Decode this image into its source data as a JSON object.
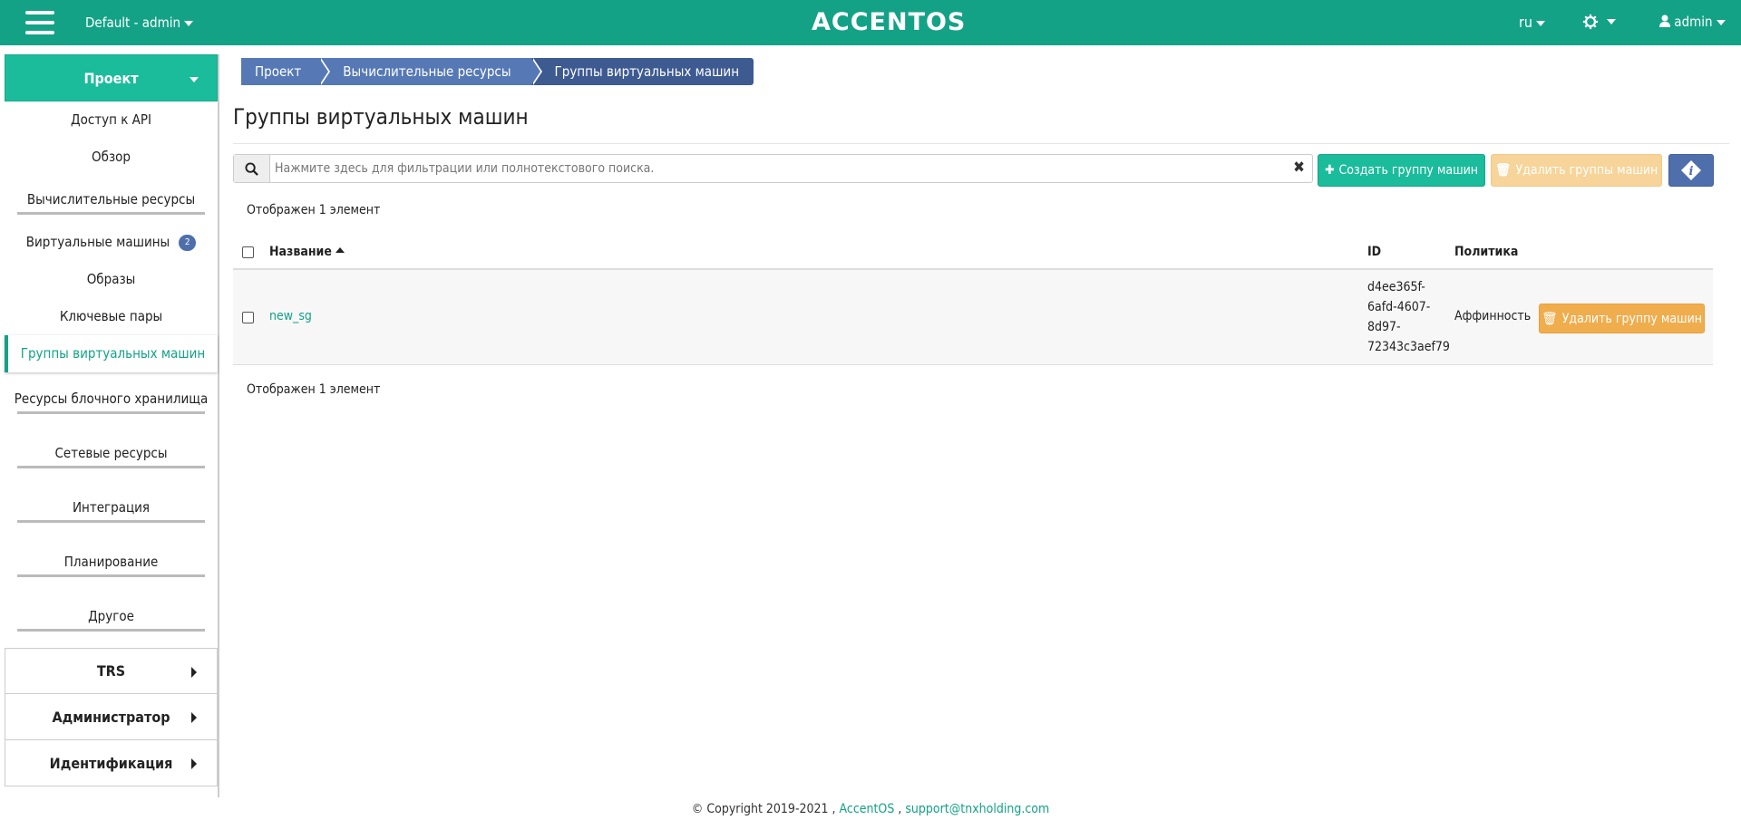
{
  "header": {
    "project": "Default - admin",
    "logo": "ACCENTOS",
    "lang": "ru",
    "user": "admin"
  },
  "sidebar": {
    "project_label": "Проект",
    "items": [
      {
        "label": "Доступ к API"
      },
      {
        "label": "Обзор"
      }
    ],
    "compute_group": "Вычислительные ресурсы",
    "compute_items": [
      {
        "label": "Виртуальные машины",
        "badge": "2"
      },
      {
        "label": "Образы"
      },
      {
        "label": "Ключевые пары"
      },
      {
        "label": "Группы виртуальных машин"
      }
    ],
    "groups": [
      "Ресурсы блочного хранилища",
      "Сетевые ресурсы",
      "Интеграция",
      "Планирование",
      "Другое"
    ],
    "sections": [
      "TRS",
      "Администратор",
      "Идентификация"
    ]
  },
  "breadcrumb": [
    "Проект",
    "Вычислительные ресурсы",
    "Группы виртуальных машин"
  ],
  "page": {
    "title": "Группы виртуальных машин",
    "search_placeholder": "Нажмите здесь для фильтрации или полнотекстового поиска.",
    "create_btn": "Создать группу машин",
    "delete_all_btn": "Удалить группы машин",
    "count_text": "Отображен 1 элемент"
  },
  "table": {
    "columns": {
      "name": "Название",
      "id": "ID",
      "policy": "Политика"
    },
    "rows": [
      {
        "name": "new_sg",
        "id_lines": [
          "d4ee365f-",
          "6afd-4607-",
          "8d97-",
          "72343c3aef79"
        ],
        "policy": "Аффинность",
        "action": "Удалить группу машин"
      }
    ]
  },
  "footer": {
    "copyright": "© Copyright 2019-2021 ,",
    "brand": "AccentOS",
    "sep": ",",
    "email": "support@tnxholding.com"
  },
  "colors": {
    "brand": "#14a287",
    "primary": "#4e6fab",
    "warning": "#f0ad4e"
  }
}
